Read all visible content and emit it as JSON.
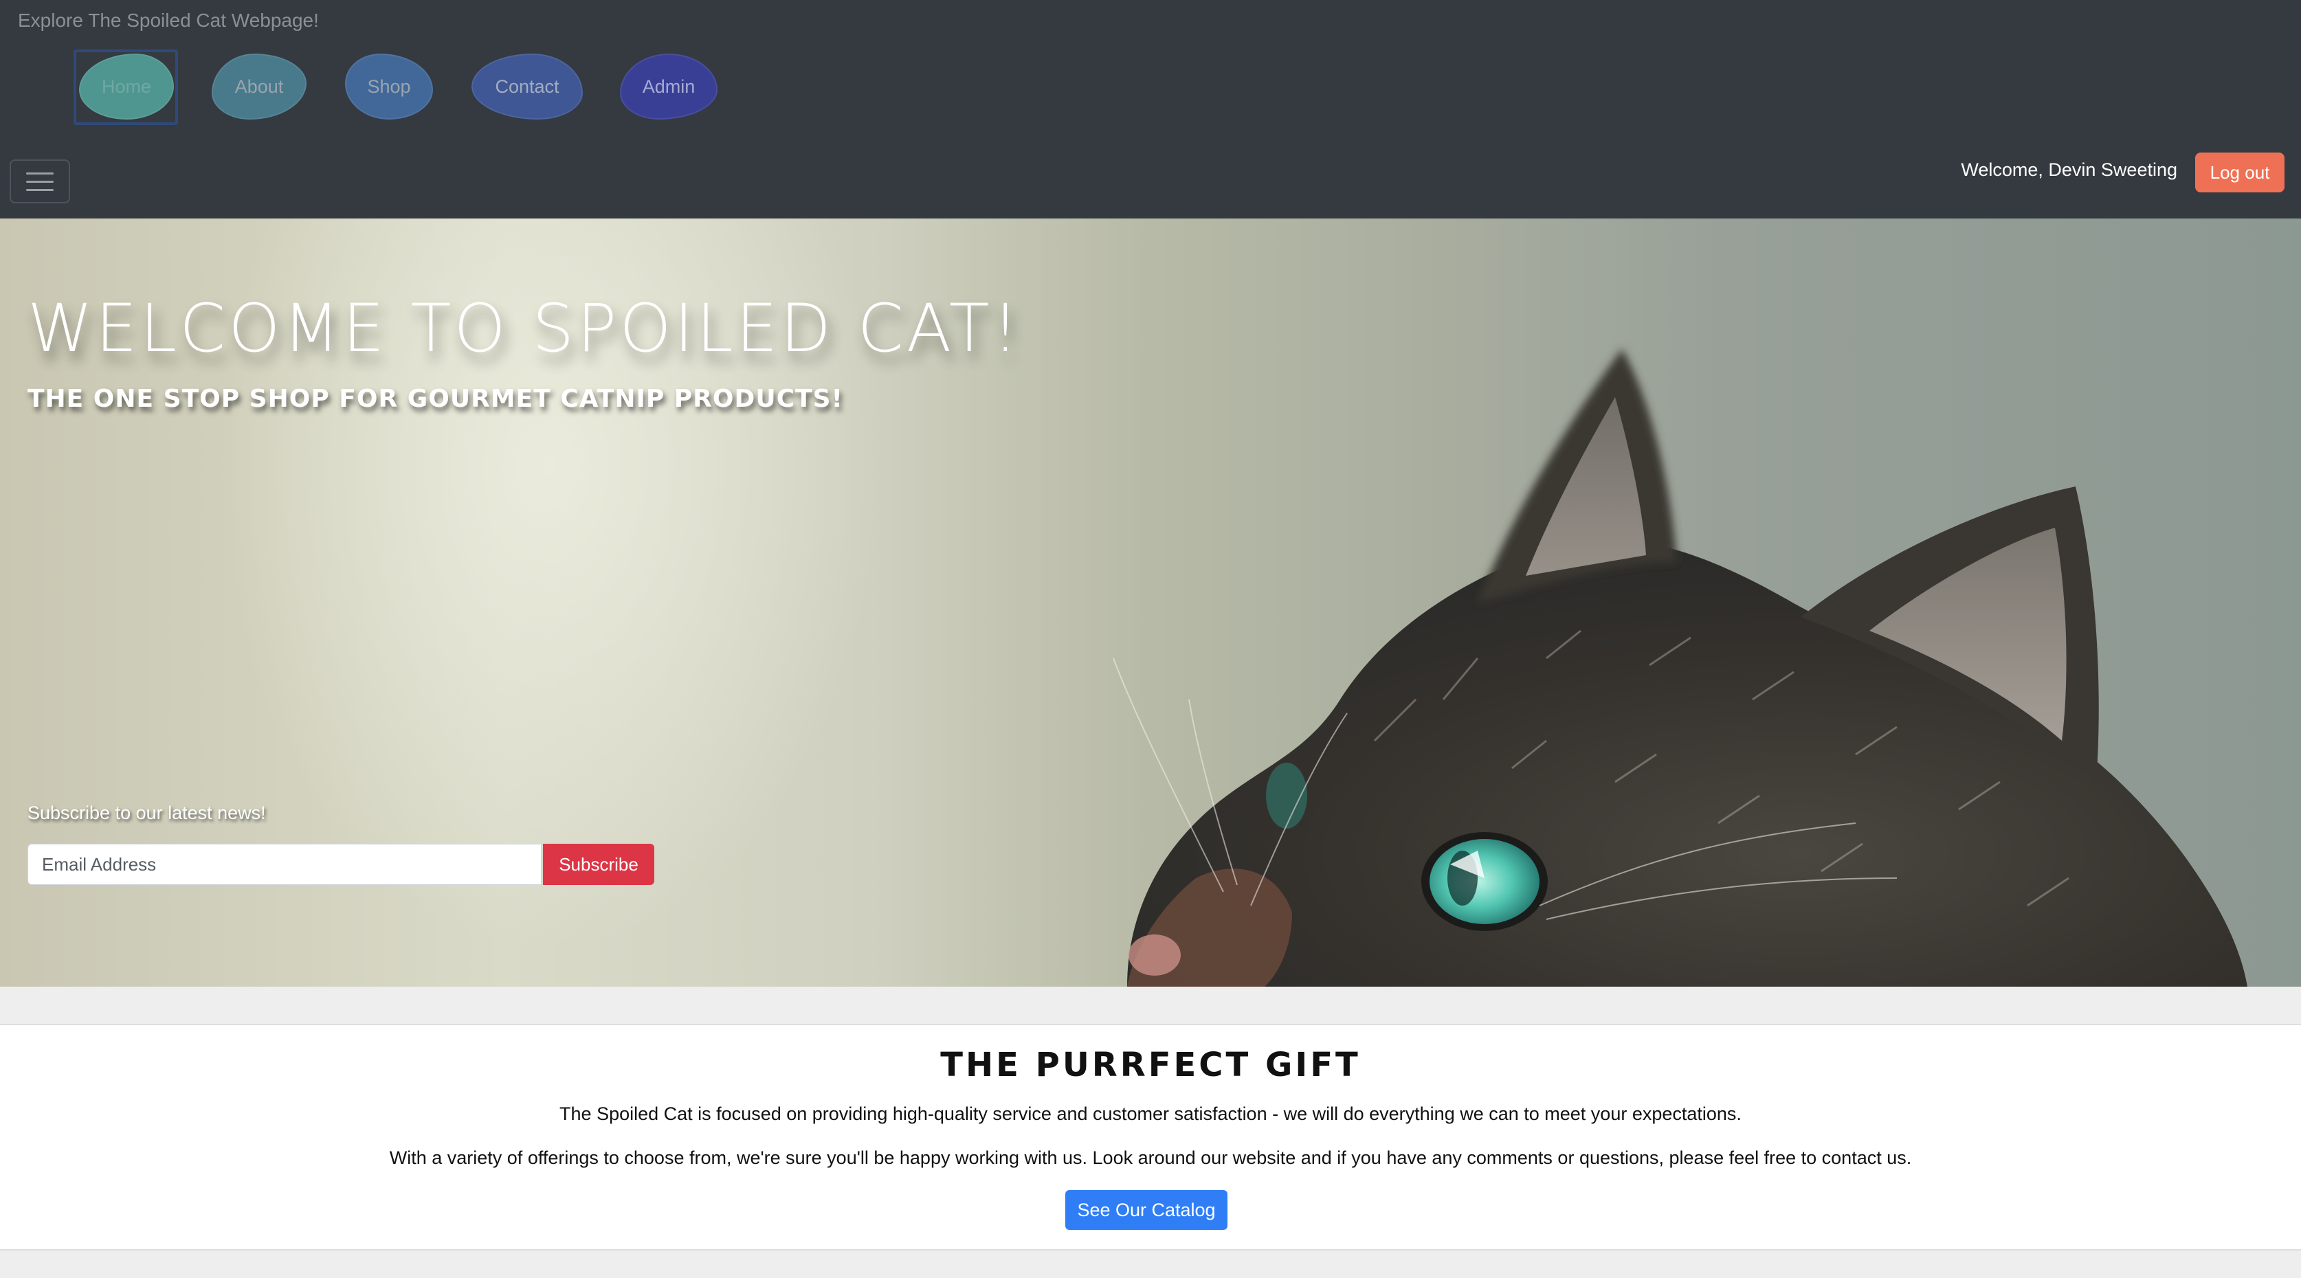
{
  "header": {
    "tagline": "Explore The Spoiled Cat Webpage!",
    "nav": {
      "home": "Home",
      "about": "About",
      "shop": "Shop",
      "contact": "Contact",
      "admin": "Admin"
    },
    "welcome_text": "Welcome, Devin Sweeting",
    "logout_label": "Log out"
  },
  "hero": {
    "title": "WELCOME TO SPOILED CAT!",
    "subtitle": "THE ONE STOP SHOP FOR GOURMET CATNIP PRODUCTS!",
    "subscribe_label": "Subscribe to our latest news!",
    "email_placeholder": "Email Address",
    "subscribe_button": "Subscribe"
  },
  "about": {
    "title": "THE PURRFECT GIFT",
    "paragraph_1": "The Spoiled Cat is focused on providing high-quality service and customer satisfaction - we will do everything we can to meet your expectations.",
    "paragraph_2": "With a variety of offerings to choose from, we're sure you'll be happy working with us. Look around our website and if you have any comments or questions, please feel free to contact us.",
    "catalog_button": "See Our Catalog"
  },
  "colors": {
    "navbar": "#343a40",
    "logout": "#ef7155",
    "subscribe": "#dc3545",
    "catalog": "#2f7ef6"
  },
  "icons": {
    "menu": "hamburger-menu-icon"
  }
}
